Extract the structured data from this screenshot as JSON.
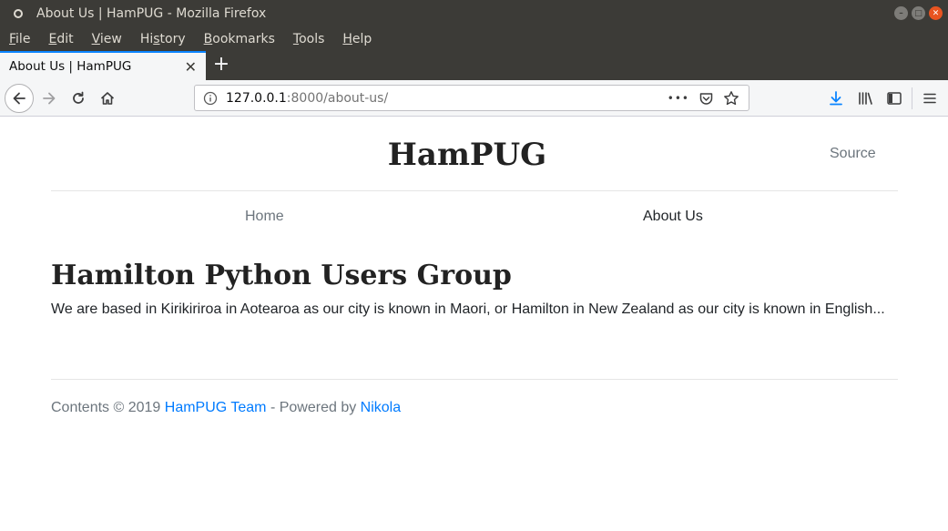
{
  "window": {
    "title": "About Us | HamPUG - Mozilla Firefox"
  },
  "menubar": {
    "items": [
      {
        "accel": "F",
        "rest": "ile"
      },
      {
        "accel": "E",
        "rest": "dit"
      },
      {
        "accel": "V",
        "rest": "iew"
      },
      {
        "pre": "Hi",
        "accel": "s",
        "rest": "tory"
      },
      {
        "accel": "B",
        "rest": "ookmarks"
      },
      {
        "accel": "T",
        "rest": "ools"
      },
      {
        "accel": "H",
        "rest": "elp"
      }
    ]
  },
  "tab": {
    "title": "About Us | HamPUG",
    "close_glyph": "✕",
    "new_tab_glyph": "+"
  },
  "urlbar": {
    "host": "127.0.0.1",
    "path": ":8000/about-us/",
    "more_glyph": "•••"
  },
  "site": {
    "title": "HamPUG",
    "source_link": "Source",
    "nav": {
      "home": "Home",
      "about": "About Us"
    },
    "heading": "Hamilton Python Users Group",
    "intro": "We are based in Kirikiriroa in Aotearoa as our city is known in Maori, or Hamilton in New Zealand as our city is known in English...",
    "footer": {
      "prefix": "Contents © 2019 ",
      "team_link": "HamPUG Team",
      "middle": " - Powered by ",
      "nikola_link": "Nikola"
    }
  },
  "colors": {
    "chrome_dark": "#3c3b37",
    "link_blue": "#007bff",
    "download_blue": "#0a84ff",
    "muted_text": "#6c757d"
  },
  "icons": [
    "back-arrow-icon",
    "forward-arrow-icon",
    "reload-icon",
    "home-icon",
    "info-icon",
    "pocket-icon",
    "bookmark-star-icon",
    "download-icon",
    "library-icon",
    "sidebar-icon",
    "hamburger-menu-icon"
  ]
}
